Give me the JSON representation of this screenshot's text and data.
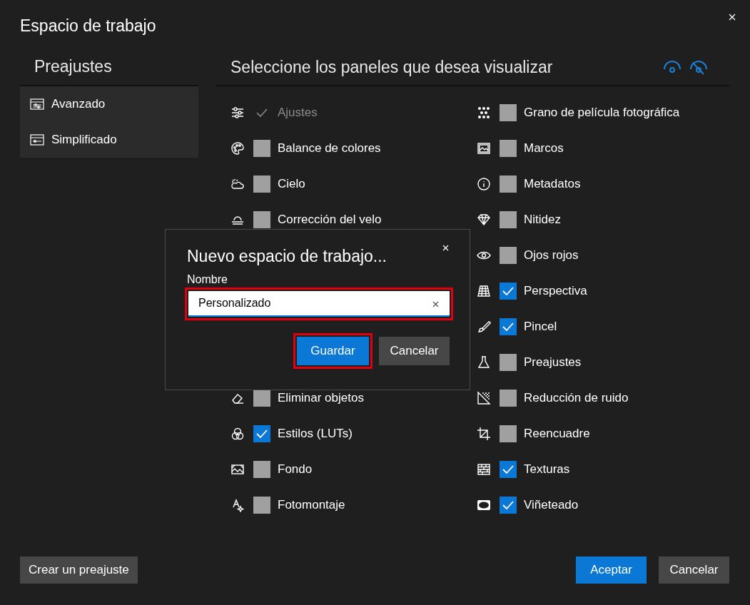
{
  "window": {
    "title": "Espacio de trabajo"
  },
  "presets": {
    "title": "Preajustes",
    "items": [
      {
        "label": "Avanzado",
        "selected": false
      },
      {
        "label": "Simplificado",
        "selected": false
      }
    ]
  },
  "panels": {
    "title": "Seleccione los paneles que desea visualizar",
    "column_1_upper": [
      {
        "label": "Ajustes",
        "checked": true,
        "disabled": true
      },
      {
        "label": "Balance de colores",
        "checked": false,
        "disabled": false
      },
      {
        "label": "Cielo",
        "checked": false,
        "disabled": false
      },
      {
        "label": "Corrección del velo",
        "checked": false,
        "disabled": false
      }
    ],
    "column_1_lower": [
      {
        "label": "Eliminar objetos",
        "checked": false,
        "disabled": false
      },
      {
        "label": "Estilos (LUTs)",
        "checked": true,
        "disabled": false
      },
      {
        "label": "Fondo",
        "checked": false,
        "disabled": false
      },
      {
        "label": "Fotomontaje",
        "checked": false,
        "disabled": false
      }
    ],
    "column_2": [
      {
        "label": "Grano de película fotográfica",
        "checked": false,
        "disabled": false
      },
      {
        "label": "Marcos",
        "checked": false,
        "disabled": false
      },
      {
        "label": "Metadatos",
        "checked": false,
        "disabled": false
      },
      {
        "label": "Nitidez",
        "checked": false,
        "disabled": false
      },
      {
        "label": "Ojos rojos",
        "checked": false,
        "disabled": false
      },
      {
        "label": "Perspectiva",
        "checked": true,
        "disabled": false
      },
      {
        "label": "Pincel",
        "checked": true,
        "disabled": false
      },
      {
        "label": "Preajustes",
        "checked": false,
        "disabled": false
      },
      {
        "label": "Reducción de ruido",
        "checked": false,
        "disabled": false
      },
      {
        "label": "Reencuadre",
        "checked": false,
        "disabled": false
      },
      {
        "label": "Texturas",
        "checked": true,
        "disabled": false
      },
      {
        "label": "Viñeteado",
        "checked": true,
        "disabled": false
      }
    ]
  },
  "footer": {
    "create_button": "Crear un preajuste",
    "ok_button": "Aceptar",
    "cancel_button": "Cancelar"
  },
  "dialog": {
    "title": "Nuevo espacio de trabajo...",
    "field_label": "Nombre",
    "field": {
      "value": "Personalizado",
      "highlighted": true
    },
    "save_button": {
      "label": "Guardar",
      "highlighted": true
    },
    "cancel_button": {
      "label": "Cancelar"
    }
  }
}
